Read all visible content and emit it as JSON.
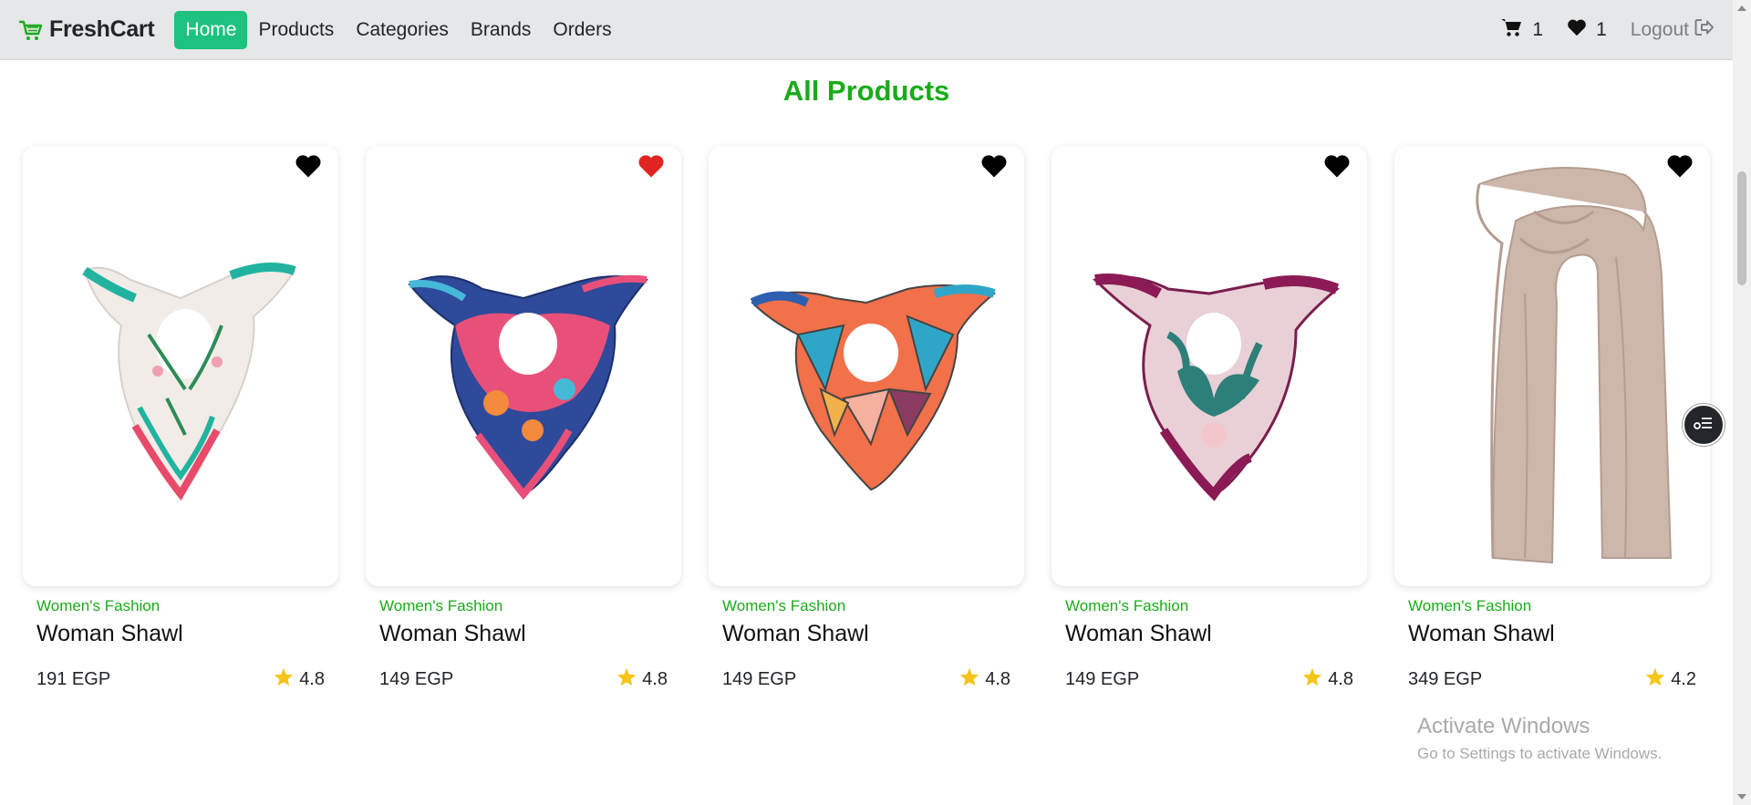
{
  "navbar": {
    "brand": "FreshCart",
    "links": [
      {
        "label": "Home",
        "active": true
      },
      {
        "label": "Products",
        "active": false
      },
      {
        "label": "Categories",
        "active": false
      },
      {
        "label": "Brands",
        "active": false
      },
      {
        "label": "Orders",
        "active": false
      }
    ],
    "cart_count": "1",
    "wishlist_count": "1",
    "logout_label": "Logout",
    "icons": {
      "brand": "cart-icon",
      "cart": "cart-icon",
      "wishlist": "heart-icon",
      "logout": "logout-icon"
    }
  },
  "main": {
    "title": "All Products",
    "products": [
      {
        "category": "Women's Fashion",
        "name": "Woman Shawl",
        "price": "191 EGP",
        "rating": "4.8",
        "wishlisted": false,
        "image": "floral-scarf"
      },
      {
        "category": "Women's Fashion",
        "name": "Woman Shawl",
        "price": "149 EGP",
        "rating": "4.8",
        "wishlisted": true,
        "image": "multicolor-scarf"
      },
      {
        "category": "Women's Fashion",
        "name": "Woman Shawl",
        "price": "149 EGP",
        "rating": "4.8",
        "wishlisted": false,
        "image": "geometric-scarf"
      },
      {
        "category": "Women's Fashion",
        "name": "Woman Shawl",
        "price": "149 EGP",
        "rating": "4.8",
        "wishlisted": false,
        "image": "magenta-scarf"
      },
      {
        "category": "Women's Fashion",
        "name": "Woman Shawl",
        "price": "349 EGP",
        "rating": "4.2",
        "wishlisted": false,
        "image": "beige-long-scarf"
      }
    ]
  },
  "watermark": {
    "title": "Activate Windows",
    "subtitle": "Go to Settings to activate Windows."
  },
  "colors": {
    "accent": "#1ec27f",
    "brand_green": "#1aab1a",
    "heart_active": "#e02424",
    "star": "#f5c518"
  }
}
